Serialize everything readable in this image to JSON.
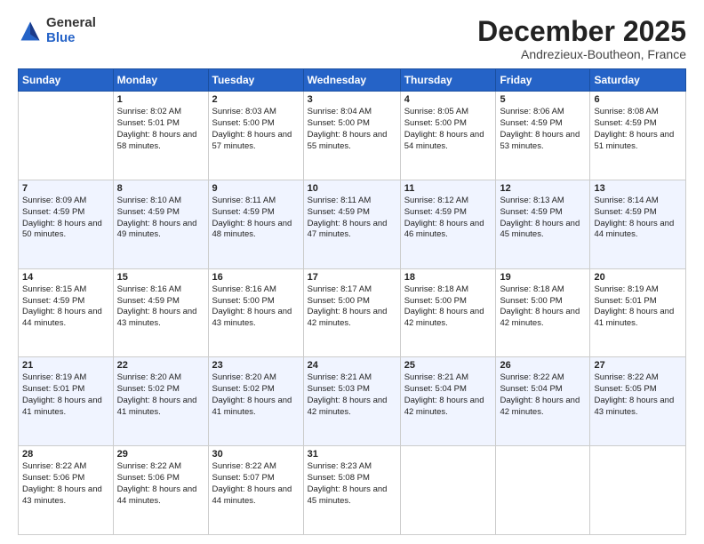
{
  "logo": {
    "general": "General",
    "blue": "Blue"
  },
  "header": {
    "month": "December 2025",
    "location": "Andrezieux-Boutheon, France"
  },
  "weekdays": [
    "Sunday",
    "Monday",
    "Tuesday",
    "Wednesday",
    "Thursday",
    "Friday",
    "Saturday"
  ],
  "weeks": [
    [
      {
        "day": "",
        "sunrise": "",
        "sunset": "",
        "daylight": ""
      },
      {
        "day": "1",
        "sunrise": "Sunrise: 8:02 AM",
        "sunset": "Sunset: 5:01 PM",
        "daylight": "Daylight: 8 hours and 58 minutes."
      },
      {
        "day": "2",
        "sunrise": "Sunrise: 8:03 AM",
        "sunset": "Sunset: 5:00 PM",
        "daylight": "Daylight: 8 hours and 57 minutes."
      },
      {
        "day": "3",
        "sunrise": "Sunrise: 8:04 AM",
        "sunset": "Sunset: 5:00 PM",
        "daylight": "Daylight: 8 hours and 55 minutes."
      },
      {
        "day": "4",
        "sunrise": "Sunrise: 8:05 AM",
        "sunset": "Sunset: 5:00 PM",
        "daylight": "Daylight: 8 hours and 54 minutes."
      },
      {
        "day": "5",
        "sunrise": "Sunrise: 8:06 AM",
        "sunset": "Sunset: 4:59 PM",
        "daylight": "Daylight: 8 hours and 53 minutes."
      },
      {
        "day": "6",
        "sunrise": "Sunrise: 8:08 AM",
        "sunset": "Sunset: 4:59 PM",
        "daylight": "Daylight: 8 hours and 51 minutes."
      }
    ],
    [
      {
        "day": "7",
        "sunrise": "Sunrise: 8:09 AM",
        "sunset": "Sunset: 4:59 PM",
        "daylight": "Daylight: 8 hours and 50 minutes."
      },
      {
        "day": "8",
        "sunrise": "Sunrise: 8:10 AM",
        "sunset": "Sunset: 4:59 PM",
        "daylight": "Daylight: 8 hours and 49 minutes."
      },
      {
        "day": "9",
        "sunrise": "Sunrise: 8:11 AM",
        "sunset": "Sunset: 4:59 PM",
        "daylight": "Daylight: 8 hours and 48 minutes."
      },
      {
        "day": "10",
        "sunrise": "Sunrise: 8:11 AM",
        "sunset": "Sunset: 4:59 PM",
        "daylight": "Daylight: 8 hours and 47 minutes."
      },
      {
        "day": "11",
        "sunrise": "Sunrise: 8:12 AM",
        "sunset": "Sunset: 4:59 PM",
        "daylight": "Daylight: 8 hours and 46 minutes."
      },
      {
        "day": "12",
        "sunrise": "Sunrise: 8:13 AM",
        "sunset": "Sunset: 4:59 PM",
        "daylight": "Daylight: 8 hours and 45 minutes."
      },
      {
        "day": "13",
        "sunrise": "Sunrise: 8:14 AM",
        "sunset": "Sunset: 4:59 PM",
        "daylight": "Daylight: 8 hours and 44 minutes."
      }
    ],
    [
      {
        "day": "14",
        "sunrise": "Sunrise: 8:15 AM",
        "sunset": "Sunset: 4:59 PM",
        "daylight": "Daylight: 8 hours and 44 minutes."
      },
      {
        "day": "15",
        "sunrise": "Sunrise: 8:16 AM",
        "sunset": "Sunset: 4:59 PM",
        "daylight": "Daylight: 8 hours and 43 minutes."
      },
      {
        "day": "16",
        "sunrise": "Sunrise: 8:16 AM",
        "sunset": "Sunset: 5:00 PM",
        "daylight": "Daylight: 8 hours and 43 minutes."
      },
      {
        "day": "17",
        "sunrise": "Sunrise: 8:17 AM",
        "sunset": "Sunset: 5:00 PM",
        "daylight": "Daylight: 8 hours and 42 minutes."
      },
      {
        "day": "18",
        "sunrise": "Sunrise: 8:18 AM",
        "sunset": "Sunset: 5:00 PM",
        "daylight": "Daylight: 8 hours and 42 minutes."
      },
      {
        "day": "19",
        "sunrise": "Sunrise: 8:18 AM",
        "sunset": "Sunset: 5:00 PM",
        "daylight": "Daylight: 8 hours and 42 minutes."
      },
      {
        "day": "20",
        "sunrise": "Sunrise: 8:19 AM",
        "sunset": "Sunset: 5:01 PM",
        "daylight": "Daylight: 8 hours and 41 minutes."
      }
    ],
    [
      {
        "day": "21",
        "sunrise": "Sunrise: 8:19 AM",
        "sunset": "Sunset: 5:01 PM",
        "daylight": "Daylight: 8 hours and 41 minutes."
      },
      {
        "day": "22",
        "sunrise": "Sunrise: 8:20 AM",
        "sunset": "Sunset: 5:02 PM",
        "daylight": "Daylight: 8 hours and 41 minutes."
      },
      {
        "day": "23",
        "sunrise": "Sunrise: 8:20 AM",
        "sunset": "Sunset: 5:02 PM",
        "daylight": "Daylight: 8 hours and 41 minutes."
      },
      {
        "day": "24",
        "sunrise": "Sunrise: 8:21 AM",
        "sunset": "Sunset: 5:03 PM",
        "daylight": "Daylight: 8 hours and 42 minutes."
      },
      {
        "day": "25",
        "sunrise": "Sunrise: 8:21 AM",
        "sunset": "Sunset: 5:04 PM",
        "daylight": "Daylight: 8 hours and 42 minutes."
      },
      {
        "day": "26",
        "sunrise": "Sunrise: 8:22 AM",
        "sunset": "Sunset: 5:04 PM",
        "daylight": "Daylight: 8 hours and 42 minutes."
      },
      {
        "day": "27",
        "sunrise": "Sunrise: 8:22 AM",
        "sunset": "Sunset: 5:05 PM",
        "daylight": "Daylight: 8 hours and 43 minutes."
      }
    ],
    [
      {
        "day": "28",
        "sunrise": "Sunrise: 8:22 AM",
        "sunset": "Sunset: 5:06 PM",
        "daylight": "Daylight: 8 hours and 43 minutes."
      },
      {
        "day": "29",
        "sunrise": "Sunrise: 8:22 AM",
        "sunset": "Sunset: 5:06 PM",
        "daylight": "Daylight: 8 hours and 44 minutes."
      },
      {
        "day": "30",
        "sunrise": "Sunrise: 8:22 AM",
        "sunset": "Sunset: 5:07 PM",
        "daylight": "Daylight: 8 hours and 44 minutes."
      },
      {
        "day": "31",
        "sunrise": "Sunrise: 8:23 AM",
        "sunset": "Sunset: 5:08 PM",
        "daylight": "Daylight: 8 hours and 45 minutes."
      },
      {
        "day": "",
        "sunrise": "",
        "sunset": "",
        "daylight": ""
      },
      {
        "day": "",
        "sunrise": "",
        "sunset": "",
        "daylight": ""
      },
      {
        "day": "",
        "sunrise": "",
        "sunset": "",
        "daylight": ""
      }
    ]
  ]
}
